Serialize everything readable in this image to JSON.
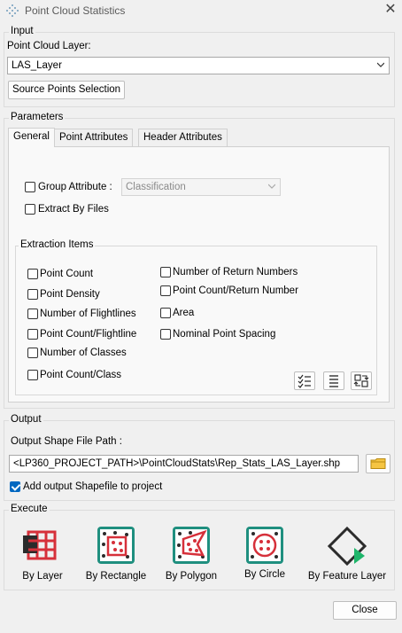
{
  "window": {
    "title": "Point Cloud Statistics",
    "close_symbol": "✕"
  },
  "input": {
    "group_label": "Input",
    "layer_label": "Point Cloud Layer:",
    "layer_value": "LAS_Layer",
    "source_button": "Source Points Selection"
  },
  "parameters": {
    "group_label": "Parameters",
    "tabs": [
      {
        "label": "General",
        "active": true
      },
      {
        "label": "Point Attributes",
        "active": false
      },
      {
        "label": "Header Attributes",
        "active": false
      }
    ],
    "group_attribute": {
      "label": "Group Attribute :",
      "checked": false,
      "value": "Classification"
    },
    "extract_by_files": {
      "label": "Extract By Files",
      "checked": false
    },
    "extraction_items": {
      "label": "Extraction Items",
      "left": [
        {
          "label": "Point Count",
          "checked": false
        },
        {
          "label": "Point Density",
          "checked": false
        },
        {
          "label": "Number of Flightlines",
          "checked": false
        },
        {
          "label": "Point Count/Flightline",
          "checked": false
        },
        {
          "label": "Number of Classes",
          "checked": false
        },
        {
          "label": "Point Count/Class",
          "checked": false
        }
      ],
      "right": [
        {
          "label": "Number of Return Numbers",
          "checked": false
        },
        {
          "label": "Point Count/Return Number",
          "checked": false
        },
        {
          "label": "Area",
          "checked": false
        },
        {
          "label": "Nominal Point Spacing",
          "checked": false
        }
      ],
      "buttons": [
        "select-all-icon",
        "list-icon",
        "invert-selection-icon"
      ]
    }
  },
  "output": {
    "group_label": "Output",
    "path_label": "Output Shape File Path :",
    "path_value": "<LP360_PROJECT_PATH>\\PointCloudStats\\Rep_Stats_LAS_Layer.shp",
    "add_to_project": {
      "label": "Add output Shapefile to project",
      "checked": true
    }
  },
  "execute": {
    "group_label": "Execute",
    "items": [
      {
        "label": "By Layer",
        "icon": "grid-layer-icon"
      },
      {
        "label": "By Rectangle",
        "icon": "rectangle-select-icon"
      },
      {
        "label": "By Polygon",
        "icon": "polygon-select-icon"
      },
      {
        "label": "By Circle",
        "icon": "circle-select-icon"
      },
      {
        "label": "By Feature Layer",
        "icon": "feature-layer-icon"
      }
    ]
  },
  "footer": {
    "close_button": "Close"
  },
  "colors": {
    "accent": "#0067c0",
    "icon_red": "#d6303a",
    "icon_teal": "#1f8f7f",
    "icon_dark": "#2b2b2b",
    "window_bg": "#f0f0f0"
  }
}
